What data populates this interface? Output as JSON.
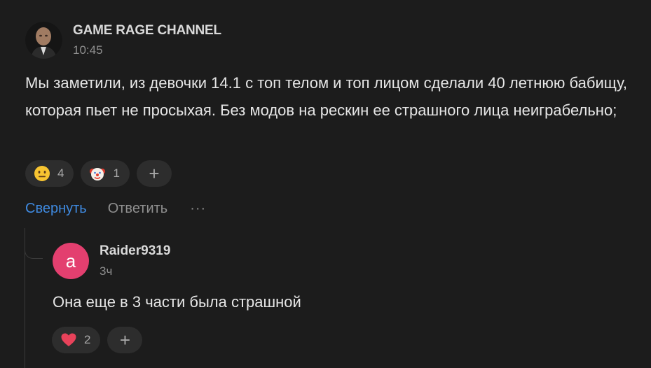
{
  "comment": {
    "author": "GAME RAGE CHANNEL",
    "time": "10:45",
    "text": "Мы заметили, из девочки 14.1 с топ телом и топ лицом сделали 40 летнюю бабищу, которая пьет не просыхая. Без модов на рескин ее страшного лица неиграбельно;",
    "reactions": [
      {
        "icon": "neutral-face-emoji",
        "count": "4"
      },
      {
        "icon": "clown-face-emoji",
        "count": "1"
      }
    ],
    "add_reaction_label": "+"
  },
  "actions": {
    "collapse": "Свернуть",
    "reply": "Ответить",
    "more": "···"
  },
  "reply": {
    "avatar_letter": "a",
    "avatar_color": "#e33f6f",
    "author": "Raider9319",
    "time": "3ч",
    "text": "Она еще в 3 части была страшной",
    "reactions": [
      {
        "icon": "heart-emoji",
        "count": "2"
      }
    ],
    "add_reaction_label": "+"
  },
  "colors": {
    "background": "#1c1c1c",
    "link": "#3f8ae0",
    "pill": "#2d2d2d"
  }
}
